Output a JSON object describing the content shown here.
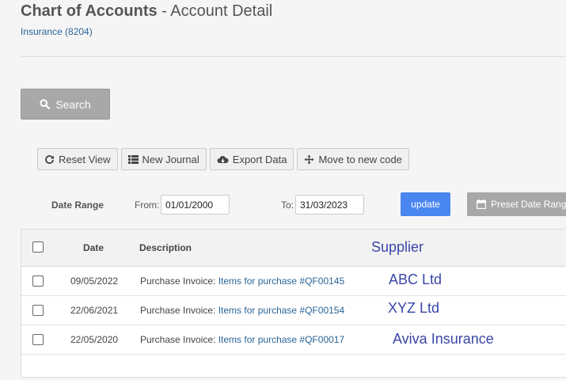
{
  "header": {
    "title_bold": "Chart of Accounts",
    "title_rest": " - Account Detail",
    "account": "Insurance (8204)"
  },
  "search": {
    "label": "Search"
  },
  "toolbar": {
    "reset_view": "Reset View",
    "new_journal": "New Journal",
    "export_data": "Export Data",
    "move_code": "Move to new code"
  },
  "filter": {
    "date_range_label": "Date Range",
    "from_label": "From:",
    "from_value": "01/01/2000",
    "to_label": "To:",
    "to_value": "31/03/2023",
    "update_label": "update",
    "preset_label": "Preset Date Range"
  },
  "table": {
    "columns": {
      "date": "Date",
      "description": "Description",
      "supplier": "Supplier"
    },
    "rows": [
      {
        "date": "09/05/2022",
        "desc_prefix": "Purchase Invoice: ",
        "desc_link": "Items for purchase #QF00145",
        "supplier": "ABC Ltd"
      },
      {
        "date": "22/06/2021",
        "desc_prefix": "Purchase Invoice: ",
        "desc_link": "Items for purchase #QF00154",
        "supplier": "XYZ Ltd"
      },
      {
        "date": "22/05/2020",
        "desc_prefix": "Purchase Invoice: ",
        "desc_link": "Items for purchase #QF00017",
        "supplier": "Aviva Insurance"
      }
    ]
  },
  "icons": {
    "search": "search-icon",
    "reset": "refresh-icon",
    "journal": "list-icon",
    "export": "cloud-download-icon",
    "move": "move-arrows-icon",
    "calendar": "calendar-icon"
  },
  "colors": {
    "link": "#2a6496",
    "update_button": "#4a86f0",
    "disabled_button": "#a8a8a8",
    "annotation": "#3a46a8"
  }
}
